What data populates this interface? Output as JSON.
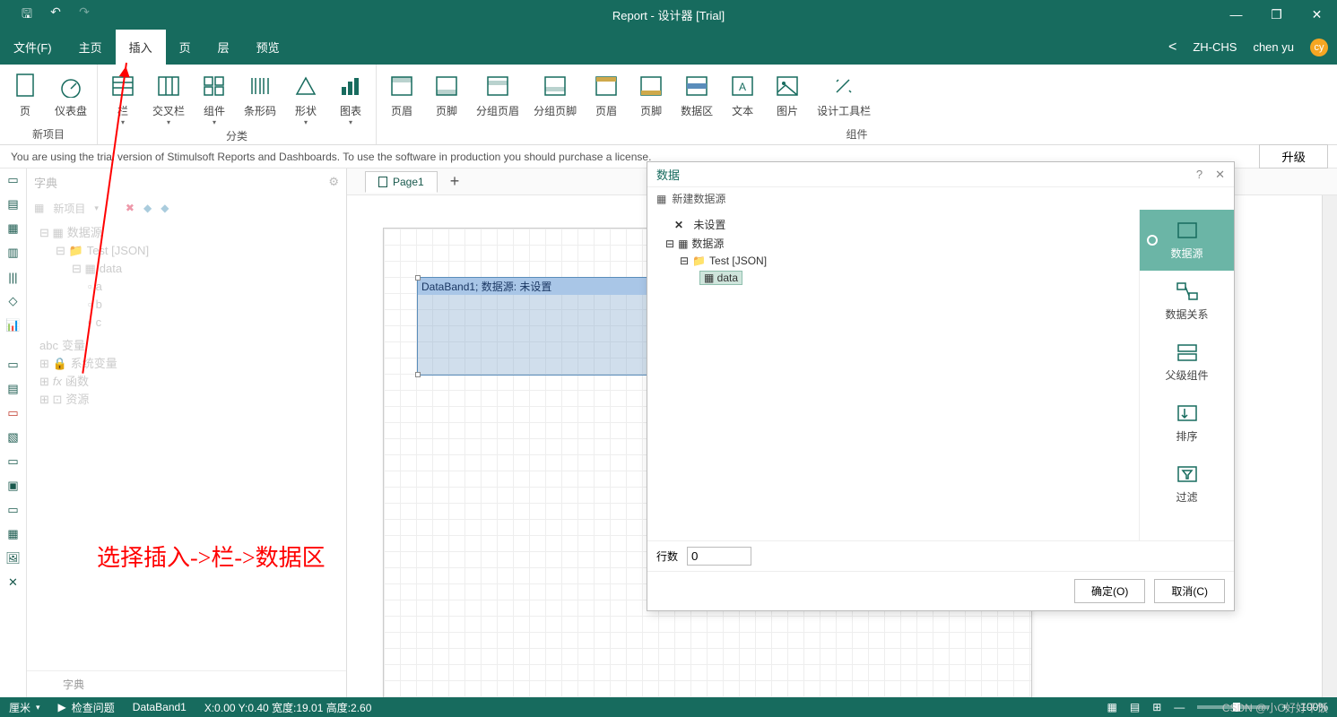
{
  "window": {
    "title": "Report - 设计器 [Trial]"
  },
  "menubar": {
    "items": [
      "文件(F)",
      "主页",
      "插入",
      "页",
      "层",
      "预览"
    ],
    "active_index": 2,
    "language": "ZH-CHS",
    "username": "chen yu",
    "avatar": "cy"
  },
  "ribbon": {
    "groups": [
      {
        "label": "新项目",
        "buttons": [
          {
            "label": "页",
            "icon": "page"
          },
          {
            "label": "仪表盘",
            "icon": "dashboard"
          }
        ]
      },
      {
        "label": "分类",
        "buttons": [
          {
            "label": "栏",
            "icon": "band",
            "dd": true
          },
          {
            "label": "交叉栏",
            "icon": "crossband",
            "dd": true
          },
          {
            "label": "组件",
            "icon": "component",
            "dd": true
          },
          {
            "label": "条形码",
            "icon": "barcode"
          },
          {
            "label": "形状",
            "icon": "shape",
            "dd": true
          },
          {
            "label": "图表",
            "icon": "chart",
            "dd": true
          }
        ]
      },
      {
        "label": "组件",
        "buttons": [
          {
            "label": "页眉",
            "icon": "header"
          },
          {
            "label": "页脚",
            "icon": "footer"
          },
          {
            "label": "分组页眉",
            "icon": "groupheader"
          },
          {
            "label": "分组页脚",
            "icon": "groupfooter"
          },
          {
            "label": "页眉",
            "icon": "colheader"
          },
          {
            "label": "页脚",
            "icon": "colfooter"
          },
          {
            "label": "数据区",
            "icon": "databand"
          },
          {
            "label": "文本",
            "icon": "text"
          },
          {
            "label": "图片",
            "icon": "image"
          },
          {
            "label": "设计工具栏",
            "icon": "designtools"
          }
        ]
      }
    ]
  },
  "trial": {
    "message": "You are using the trial version of Stimulsoft Reports and Dashboards. To use the software in production you should purchase a license.",
    "upgrade": "升级"
  },
  "dictpanel": {
    "title": "字典",
    "newitem": "新项目",
    "tree": {
      "root": "数据源",
      "test": "Test [JSON]",
      "data": "data",
      "cols": [
        "a",
        "b",
        "c"
      ],
      "variables": "变量",
      "sysvar": "系统变量",
      "funcs": "函数",
      "res": "资源"
    },
    "bottom_tab": "字典"
  },
  "workarea": {
    "tab": "Page1",
    "band_caption": "DataBand1; 数据源: 未设置"
  },
  "annotation": "选择插入->栏->数据区",
  "dialog": {
    "title": "数据",
    "newds": "新建数据源",
    "tree": {
      "unset": "未设置",
      "ds": "数据源",
      "test": "Test [JSON]",
      "data": "data"
    },
    "sidetabs": [
      "数据源",
      "数据关系",
      "父级组件",
      "排序",
      "过滤"
    ],
    "rows_label": "行数",
    "rows_value": "0",
    "ok": "确定(O)",
    "cancel": "取消(C)"
  },
  "statusbar": {
    "unit": "厘米",
    "check": "检查问题",
    "selected": "DataBand1",
    "coords": "X:0.00 Y:0.40 宽度:19.01 高度:2.60",
    "zoom": "100%"
  },
  "watermark_text": "CSDN @小C好好干饭"
}
